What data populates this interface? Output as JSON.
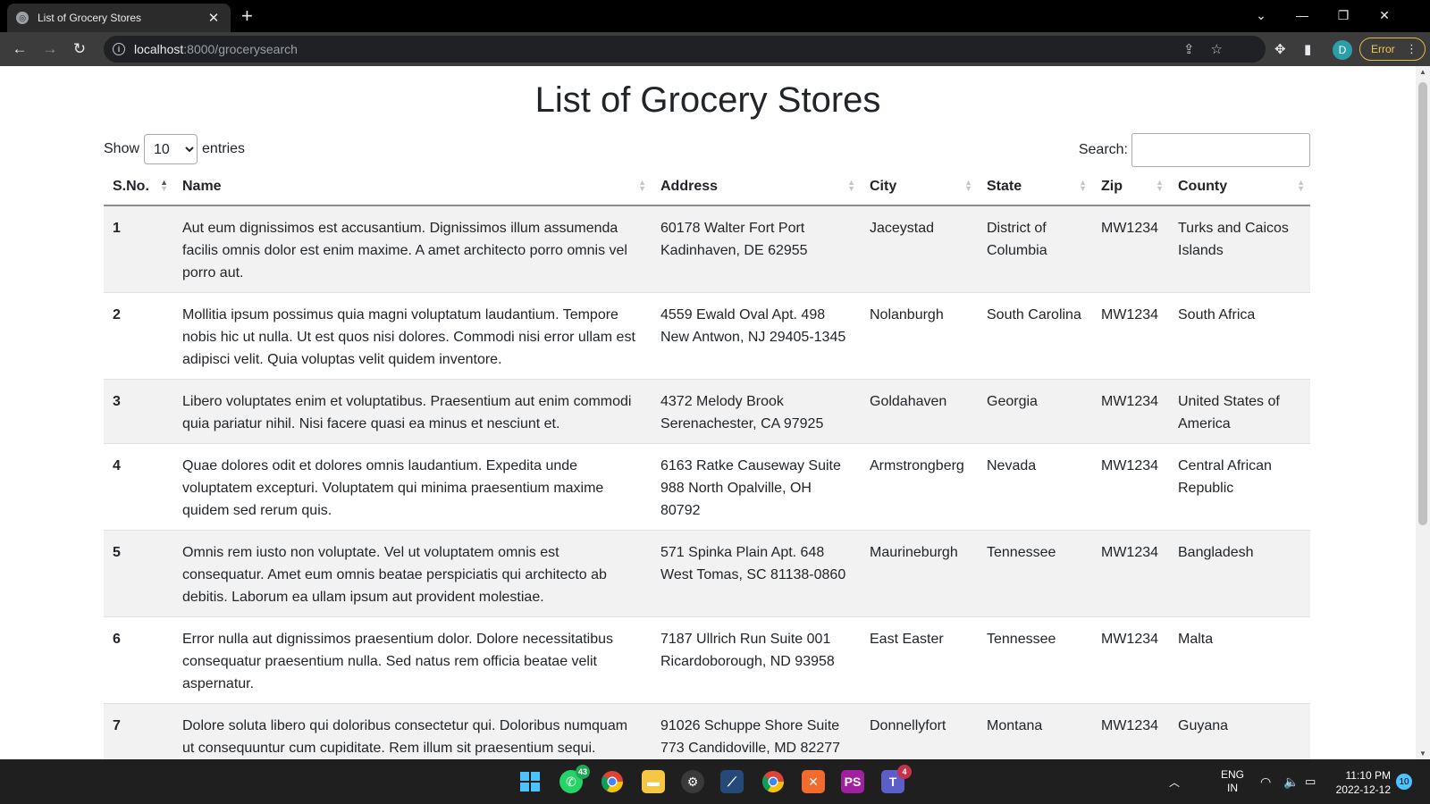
{
  "browser": {
    "tab_title": "List of Grocery Stores",
    "url_host": "localhost",
    "url_path": ":8000/grocerysearch",
    "profile_initial": "D",
    "error_label": "Error"
  },
  "page": {
    "title": "List of Grocery Stores",
    "show_label": "Show",
    "entries_label": "entries",
    "page_length": "10",
    "page_length_options": [
      "10"
    ],
    "search_label": "Search:",
    "search_value": ""
  },
  "table": {
    "columns": [
      "S.No.",
      "Name",
      "Address",
      "City",
      "State",
      "Zip",
      "County"
    ],
    "rows": [
      {
        "sno": "1",
        "name": "Aut eum dignissimos est accusantium. Dignissimos illum assumenda facilis omnis dolor est enim maxime. A amet architecto porro omnis vel porro aut.",
        "address": "60178 Walter Fort Port Kadinhaven, DE 62955",
        "city": "Jaceystad",
        "state": "District of Columbia",
        "zip": "MW1234",
        "county": "Turks and Caicos Islands"
      },
      {
        "sno": "2",
        "name": "Mollitia ipsum possimus quia magni voluptatum laudantium. Tempore nobis hic ut nulla. Ut est quos nisi dolores. Commodi nisi error ullam est adipisci velit. Quia voluptas velit quidem inventore.",
        "address": "4559 Ewald Oval Apt. 498 New Antwon, NJ 29405-1345",
        "city": "Nolanburgh",
        "state": "South Carolina",
        "zip": "MW1234",
        "county": "South Africa"
      },
      {
        "sno": "3",
        "name": "Libero voluptates enim et voluptatibus. Praesentium aut enim commodi quia pariatur nihil. Nisi facere quasi ea minus et nesciunt et.",
        "address": "4372 Melody Brook Serenachester, CA 97925",
        "city": "Goldahaven",
        "state": "Georgia",
        "zip": "MW1234",
        "county": "United States of America"
      },
      {
        "sno": "4",
        "name": "Quae dolores odit et dolores omnis laudantium. Expedita unde voluptatem excepturi. Voluptatem qui minima praesentium maxime quidem sed rerum quis.",
        "address": "6163 Ratke Causeway Suite 988 North Opalville, OH 80792",
        "city": "Armstrongberg",
        "state": "Nevada",
        "zip": "MW1234",
        "county": "Central African Republic"
      },
      {
        "sno": "5",
        "name": "Omnis rem iusto non voluptate. Vel ut voluptatem omnis est consequatur. Amet eum omnis beatae perspiciatis qui architecto ab debitis. Laborum ea ullam ipsum aut provident molestiae.",
        "address": "571 Spinka Plain Apt. 648 West Tomas, SC 81138-0860",
        "city": "Maurineburgh",
        "state": "Tennessee",
        "zip": "MW1234",
        "county": "Bangladesh"
      },
      {
        "sno": "6",
        "name": "Error nulla aut dignissimos praesentium dolor. Dolore necessitatibus consequatur praesentium nulla. Sed natus rem officia beatae velit aspernatur.",
        "address": "7187 Ullrich Run Suite 001 Ricardoborough, ND 93958",
        "city": "East Easter",
        "state": "Tennessee",
        "zip": "MW1234",
        "county": "Malta"
      },
      {
        "sno": "7",
        "name": "Dolore soluta libero qui doloribus consectetur qui. Doloribus numquam ut consequuntur cum cupiditate. Rem illum sit praesentium sequi.",
        "address": "91026 Schuppe Shore Suite 773 Candidoville, MD 82277",
        "city": "Donnellyfort",
        "state": "Montana",
        "zip": "MW1234",
        "county": "Guyana"
      }
    ]
  },
  "taskbar": {
    "whatsapp_badge": "43",
    "teams_badge": "4",
    "lang_line1": "ENG",
    "lang_line2": "IN",
    "time": "11:10 PM",
    "date": "2022-12-12",
    "notification_count": "10"
  },
  "colors": {
    "tabbar_bg": "#000000",
    "toolbar_bg": "#3c3c3c",
    "stripe_bg": "#f2f2f2",
    "taskbar_bg": "#1f1f1f",
    "error_accent": "#f2c94c",
    "profile_bg": "#2a9fa8"
  }
}
